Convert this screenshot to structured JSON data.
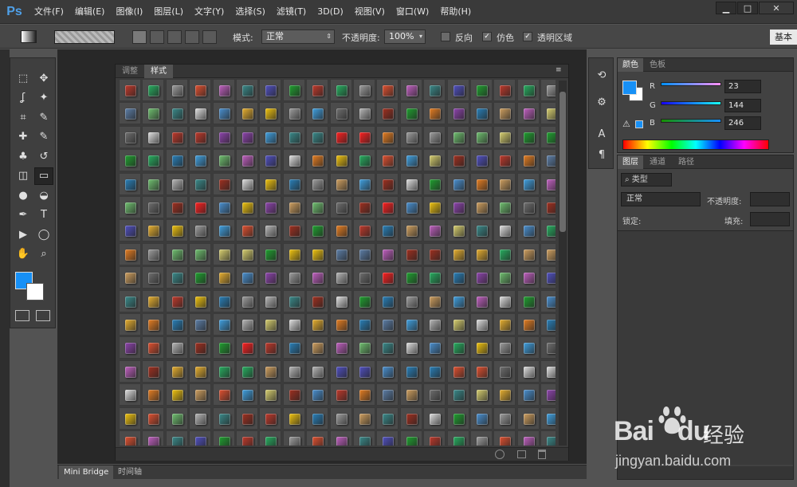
{
  "app": {
    "logo": "Ps"
  },
  "menu": [
    "文件(F)",
    "编辑(E)",
    "图像(I)",
    "图层(L)",
    "文字(Y)",
    "选择(S)",
    "滤镜(T)",
    "3D(D)",
    "视图(V)",
    "窗口(W)",
    "帮助(H)"
  ],
  "window_controls": {
    "minimize": "▁",
    "maximize": "□",
    "close": "✕"
  },
  "options": {
    "mode_label": "模式:",
    "mode_value": "正常",
    "opacity_label": "不透明度:",
    "opacity_value": "100%",
    "reverse_label": "反向",
    "reverse_checked": false,
    "dither_label": "仿色",
    "dither_checked": true,
    "transparency_label": "透明区域",
    "transparency_checked": true,
    "workspace_button": "基本"
  },
  "styles_panel": {
    "tabs": [
      "调整",
      "样式"
    ],
    "active_tab": "样式",
    "collapse": "◂◂",
    "close": "✕",
    "menu": "≡"
  },
  "colors_panel": {
    "tabs": [
      "颜色",
      "色板"
    ],
    "active_tab": "颜色",
    "channels": [
      {
        "label": "R",
        "value": "23"
      },
      {
        "label": "G",
        "value": "144"
      },
      {
        "label": "B",
        "value": "246"
      }
    ],
    "foreground": "#1790f6",
    "background": "#ffffff"
  },
  "layers_panel": {
    "tabs": [
      "图层",
      "通道",
      "路径"
    ],
    "active_tab": "图层",
    "filter_label": "类型",
    "blend_mode": "正常",
    "opacity_label": "不透明度:",
    "lock_label": "锁定:",
    "fill_label": "填充:"
  },
  "bottom_tabs": [
    "Mini Bridge",
    "时间轴"
  ],
  "watermark": {
    "brand": "Bai",
    "brand2": "du",
    "cn": "经验",
    "url": "jingyan.baidu.com"
  },
  "icons": {
    "tools": [
      "marquee-icon",
      "move-icon",
      "lasso-icon",
      "magic-wand-icon",
      "crop-icon",
      "eyedropper-icon",
      "healing-icon",
      "brush-icon",
      "stamp-icon",
      "history-brush-icon",
      "eraser-icon",
      "gradient-icon",
      "blur-icon",
      "dodge-icon",
      "pen-icon",
      "type-icon",
      "path-select-icon",
      "ellipse-icon",
      "hand-icon",
      "zoom-icon"
    ]
  },
  "swatch_palette": [
    "#c0392b",
    "#e67e22",
    "#f1c40f",
    "#27ae60",
    "#2980b9",
    "#8e44ad",
    "#9e9e9e",
    "#5d7fa8",
    "#d0a060",
    "#e05030",
    "#40a0e0",
    "#70c070",
    "#c060c0",
    "#b8b8b8",
    "#707070",
    "#3a8a8a",
    "#d8d070",
    "#a03020",
    "#5050c0",
    "#e0e0e0",
    "#ff2020",
    "#20a030",
    "#e8b030",
    "#4a90d0"
  ]
}
